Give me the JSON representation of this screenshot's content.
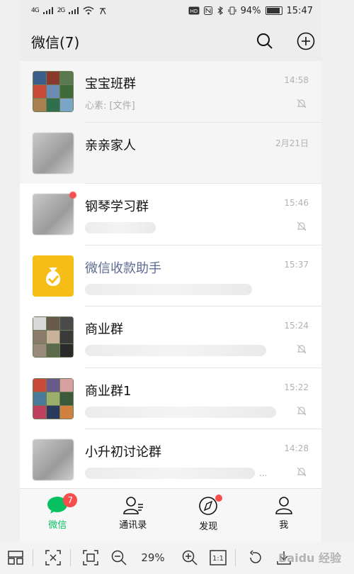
{
  "status": {
    "network1": "4G",
    "network2": "2G",
    "battery_pct": "94%",
    "time": "15:47"
  },
  "header": {
    "title": "微信(7)"
  },
  "chats": [
    {
      "name": "宝宝班群",
      "preview": "心素: [文件]",
      "time": "14:58",
      "muted": true
    },
    {
      "name": "亲亲家人",
      "preview": "",
      "time": "2月21日",
      "muted": false
    },
    {
      "name": "钢琴学习群",
      "preview": "",
      "time": "15:46",
      "muted": true
    },
    {
      "name": "微信收款助手",
      "preview": "",
      "time": "15:37",
      "muted": false
    },
    {
      "name": "商业群",
      "preview": "",
      "time": "15:24",
      "muted": true
    },
    {
      "name": "商业群1",
      "preview": "",
      "time": "15:22",
      "muted": true
    },
    {
      "name": "小升初讨论群",
      "preview": "...",
      "time": "14:28",
      "muted": true
    }
  ],
  "tabs": [
    {
      "label": "微信",
      "badge": "7"
    },
    {
      "label": "通讯录"
    },
    {
      "label": "发现"
    },
    {
      "label": "我"
    }
  ],
  "viewer": {
    "zoom": "29%",
    "ratio": "1:1",
    "watermark": "Baidu 经验"
  },
  "colors": {
    "accent": "#07c160",
    "badge": "#f64d4d",
    "service_name": "#5b6b92",
    "pay_avatar": "#f5bd15"
  }
}
